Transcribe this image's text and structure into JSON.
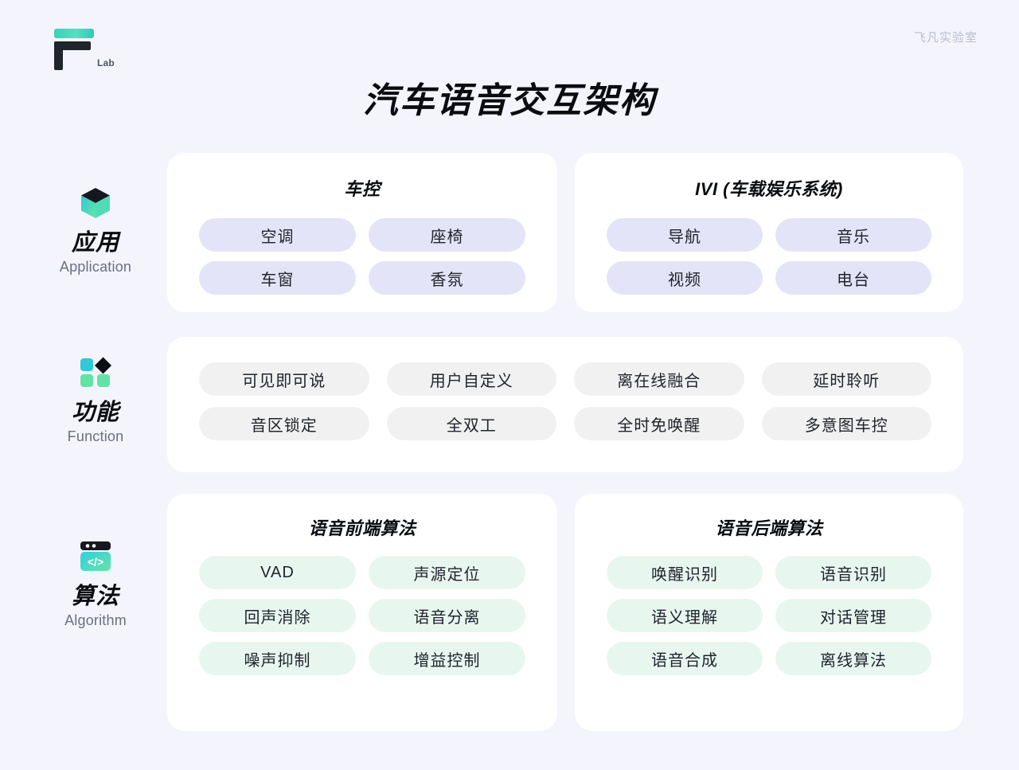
{
  "header": {
    "logo_name": "F Lab",
    "logo_sub": "Lab",
    "brand": "飞凡实验室"
  },
  "title": "汽车语音交互架构",
  "colors": {
    "page_bg": "#f4f4fd",
    "card_bg": "#ffffff",
    "chip_lavender": "#e4e4f8",
    "chip_gray": "#f1f1f2",
    "chip_mint": "#e7f7f0",
    "accent_teal": "#3ed0b4",
    "accent_green": "#5fe3a8",
    "text_dark": "#0a0c10",
    "text_muted": "#6a7080",
    "brand_muted": "#b9bdd2"
  },
  "rows": [
    {
      "id": "application",
      "label_cn": "应用",
      "label_en": "Application",
      "icon": "cube-icon",
      "cards": [
        {
          "id": "car-control",
          "title": "车控",
          "chip_style": "chip-lav",
          "chips": [
            "空调",
            "座椅",
            "车窗",
            "香氛"
          ]
        },
        {
          "id": "ivi",
          "title": "IVI (车载娱乐系统)",
          "chip_style": "chip-lav",
          "chips": [
            "导航",
            "音乐",
            "视频",
            "电台"
          ]
        }
      ]
    },
    {
      "id": "function",
      "label_cn": "功能",
      "label_en": "Function",
      "icon": "grid-diamond-icon",
      "cards": [
        {
          "id": "function-list",
          "title": "",
          "chip_style": "chip-gray",
          "chips": [
            "可见即可说",
            "用户自定义",
            "离在线融合",
            "延时聆听",
            "音区锁定",
            "全双工",
            "全时免唤醒",
            "多意图车控"
          ]
        }
      ]
    },
    {
      "id": "algorithm",
      "label_cn": "算法",
      "label_en": "Algorithm",
      "icon": "code-window-icon",
      "cards": [
        {
          "id": "front-end",
          "title": "语音前端算法",
          "chip_style": "chip-mint",
          "chips": [
            "VAD",
            "声源定位",
            "回声消除",
            "语音分离",
            "噪声抑制",
            "增益控制"
          ]
        },
        {
          "id": "back-end",
          "title": "语音后端算法",
          "chip_style": "chip-mint",
          "chips": [
            "唤醒识别",
            "语音识别",
            "语义理解",
            "对话管理",
            "语音合成",
            "离线算法"
          ]
        }
      ]
    }
  ]
}
